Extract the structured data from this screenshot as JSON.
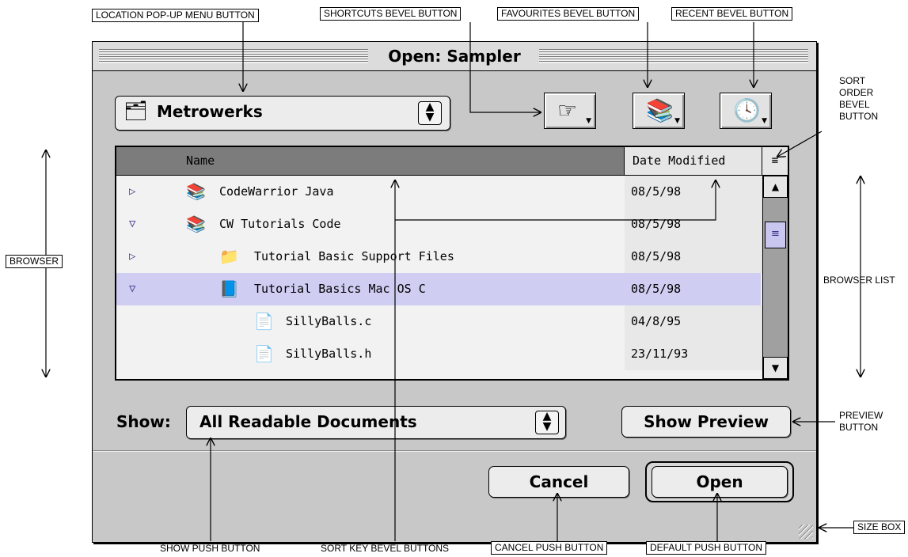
{
  "window": {
    "title": "Open: Sampler"
  },
  "location_popup": {
    "value": "Metrowerks",
    "icon": "folder-icon"
  },
  "bevel_buttons": {
    "shortcuts_icon": "hand-pointer-icon",
    "favourites_icon": "books-icon",
    "recent_icon": "clock-icon"
  },
  "browser": {
    "col_name": "Name",
    "col_date": "Date Modified",
    "rows": [
      {
        "name": "CodeWarrior Java",
        "date": "08/5/98",
        "disclosure": "closed",
        "icon": "folder-icon"
      },
      {
        "name": "CW Tutorials Code",
        "date": "08/5/98",
        "disclosure": "open",
        "icon": "folder-icon"
      },
      {
        "name": "Tutorial Basic Support Files",
        "date": "08/5/98",
        "disclosure": "closed",
        "icon": "folder-icon"
      },
      {
        "name": "Tutorial Basics Mac OS C",
        "date": "08/5/98",
        "disclosure": "open",
        "icon": "folder-icon"
      },
      {
        "name": "SillyBalls.c",
        "date": "04/8/95",
        "disclosure": "",
        "icon": "document-icon"
      },
      {
        "name": "SillyBalls.h",
        "date": "23/11/93",
        "disclosure": "",
        "icon": "document-icon"
      }
    ]
  },
  "show": {
    "label": "Show:",
    "value": "All Readable Documents"
  },
  "buttons": {
    "preview": "Show Preview",
    "cancel": "Cancel",
    "open": "Open"
  },
  "annotations": {
    "location": "LOCATION POP-UP MENU BUTTON",
    "shortcuts": "SHORTCUTS BEVEL BUTTON",
    "favourites": "FAVOURITES BEVEL BUTTON",
    "recent": "RECENT BEVEL BUTTON",
    "sort_order_1": "SORT",
    "sort_order_2": "ORDER",
    "sort_order_3": "BEVEL",
    "sort_order_4": "BUTTON",
    "browser": "BROWSER",
    "browser_list": "BROWSER LIST",
    "preview_1": "PREVIEW",
    "preview_2": "BUTTON",
    "size_box": "SIZE BOX",
    "show_push": "SHOW PUSH BUTTON",
    "sort_key": "SORT KEY BEVEL BUTTONS",
    "cancel_push": "CANCEL PUSH BUTTON",
    "default_push": "DEFAULT PUSH BUTTON"
  }
}
